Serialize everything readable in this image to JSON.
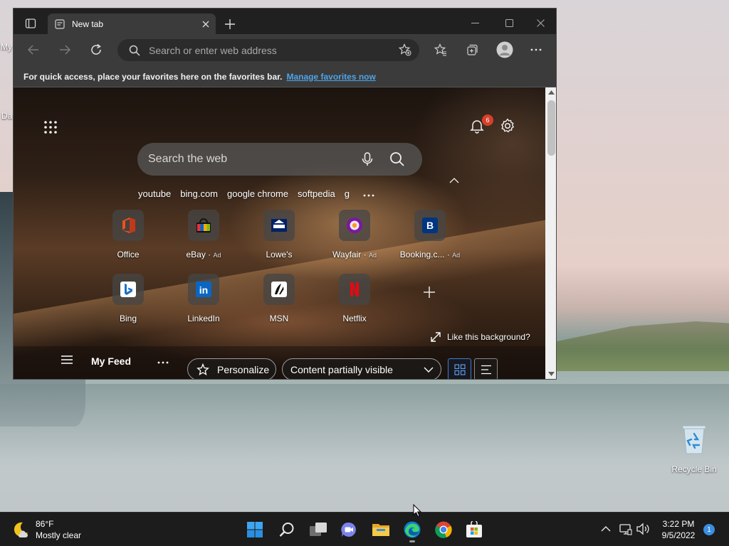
{
  "browser": {
    "tab_title": "New tab",
    "address_placeholder": "Search or enter web address",
    "favbar_message": "For quick access, place your favorites here on the favorites bar.",
    "favbar_link": "Manage favorites now"
  },
  "ntp": {
    "search_placeholder": "Search the web",
    "notification_count": "6",
    "quick_links": [
      "youtube",
      "bing.com",
      "google chrome",
      "softpedia",
      "g"
    ],
    "tiles": [
      {
        "label": "Office",
        "ad": "",
        "icon": "office-icon"
      },
      {
        "label": "eBay",
        "ad": "Ad",
        "icon": "ebay-icon"
      },
      {
        "label": "Lowe's",
        "ad": "",
        "icon": "lowes-icon"
      },
      {
        "label": "Wayfair",
        "ad": "Ad",
        "icon": "wayfair-icon"
      },
      {
        "label": "Booking.c...",
        "ad": "Ad",
        "icon": "booking-icon"
      },
      {
        "label": "Bing",
        "ad": "",
        "icon": "bing-icon"
      },
      {
        "label": "LinkedIn",
        "ad": "",
        "icon": "linkedin-icon"
      },
      {
        "label": "MSN",
        "ad": "",
        "icon": "msn-icon"
      },
      {
        "label": "Netflix",
        "ad": "",
        "icon": "netflix-icon"
      }
    ],
    "background_prompt": "Like this background?",
    "feed": {
      "title": "My Feed",
      "personalize_label": "Personalize",
      "content_selection": "Content partially visible"
    }
  },
  "desktop": {
    "recycle_bin_label": "Recycle Bin",
    "left_labels": [
      "My",
      "Da"
    ]
  },
  "taskbar": {
    "weather_temp": "86°F",
    "weather_desc": "Mostly clear",
    "time": "3:22 PM",
    "date": "9/5/2022",
    "notification_count": "1",
    "pinned_apps": [
      "start-icon",
      "search-icon",
      "task-view-icon",
      "teams-chat-icon",
      "file-explorer-icon",
      "edge-icon",
      "chrome-icon",
      "store-icon"
    ]
  },
  "colors": {
    "accent": "#3b8ee0",
    "link": "#4fa3e8",
    "badge": "#d6402b"
  }
}
